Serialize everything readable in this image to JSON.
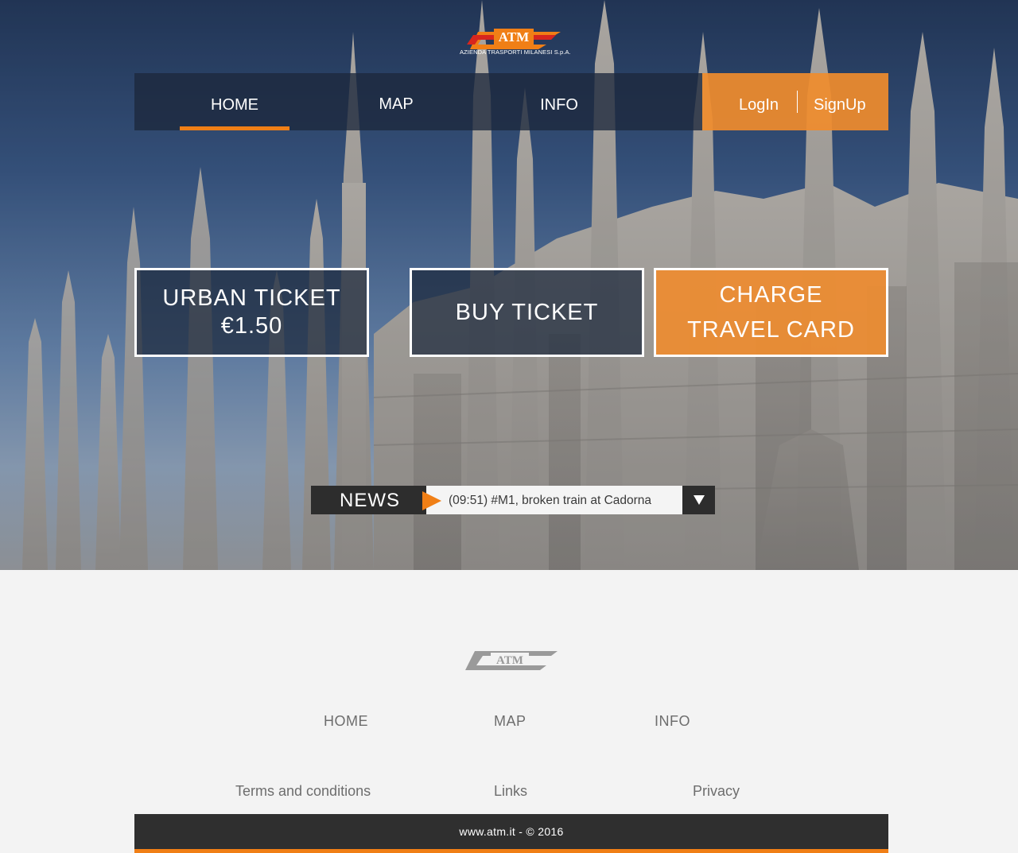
{
  "brand": {
    "logo_text": "ATM",
    "logo_caption": "AZIENDA TRASPORTI MILANESI S.p.A.",
    "accent_color": "#f07f16",
    "logo_red": "#d7261e",
    "dark_color": "#2d2d2d"
  },
  "nav": {
    "items": [
      {
        "label": "HOME",
        "active": true
      },
      {
        "label": "MAP",
        "active": false
      },
      {
        "label": "INFO",
        "active": false
      }
    ],
    "login_label": "LogIn",
    "signup_label": "SignUp"
  },
  "cards": {
    "urban_ticket": {
      "line1": "URBAN TICKET",
      "line2": "€1.50"
    },
    "buy_ticket": {
      "label": "BUY TICKET"
    },
    "charge_card": {
      "line1": "CHARGE",
      "line2": "TRAVEL CARD"
    }
  },
  "news": {
    "label": "NEWS",
    "text": "(09:51) #M1, broken train at Cadorna",
    "arrow_icon": "play-arrow-icon",
    "toggle_icon": "triangle-down-icon"
  },
  "footer": {
    "logo_text": "ATM",
    "nav": [
      "HOME",
      "MAP",
      "INFO"
    ],
    "links": [
      "Terms and conditions",
      "Links",
      "Privacy"
    ],
    "copyright": "www.atm.it - © 2016"
  }
}
